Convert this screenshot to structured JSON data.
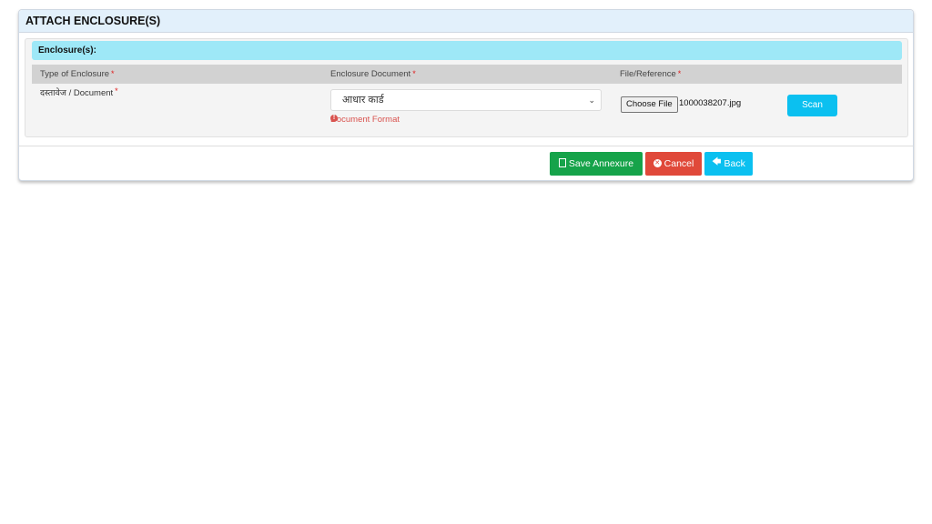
{
  "panel": {
    "title": "ATTACH ENCLOSURE(S)"
  },
  "enclosures": {
    "heading": "Enclosure(s):",
    "columns": [
      {
        "label": "Type of Enclosure",
        "required_mark": "*"
      },
      {
        "label": "Enclosure Document",
        "required_mark": "*"
      },
      {
        "label": "File/Reference",
        "required_mark": "*"
      }
    ],
    "row": {
      "type_label": "दस्तावेज / Document",
      "required_mark": "*",
      "selected_document": "आधार कार्ड",
      "format_hint": "Document Format",
      "choose_file_label": "Choose File",
      "file_name": "1000038207.jpg",
      "scan_label": "Scan"
    }
  },
  "actions": {
    "save_label": "Save Annexure",
    "cancel_label": "Cancel",
    "back_label": "Back"
  },
  "colors": {
    "save": "#16a34a",
    "cancel": "#e0493a",
    "back": "#0bc0f0",
    "scan": "#0bc0f0",
    "enclosure_heading_bg": "#9ee8f7"
  },
  "icons": {
    "save": "file-icon",
    "cancel": "times-circle-icon",
    "back": "arrow-left-icon",
    "format_hint": "info-circle-icon",
    "select": "chevron-down-icon"
  }
}
